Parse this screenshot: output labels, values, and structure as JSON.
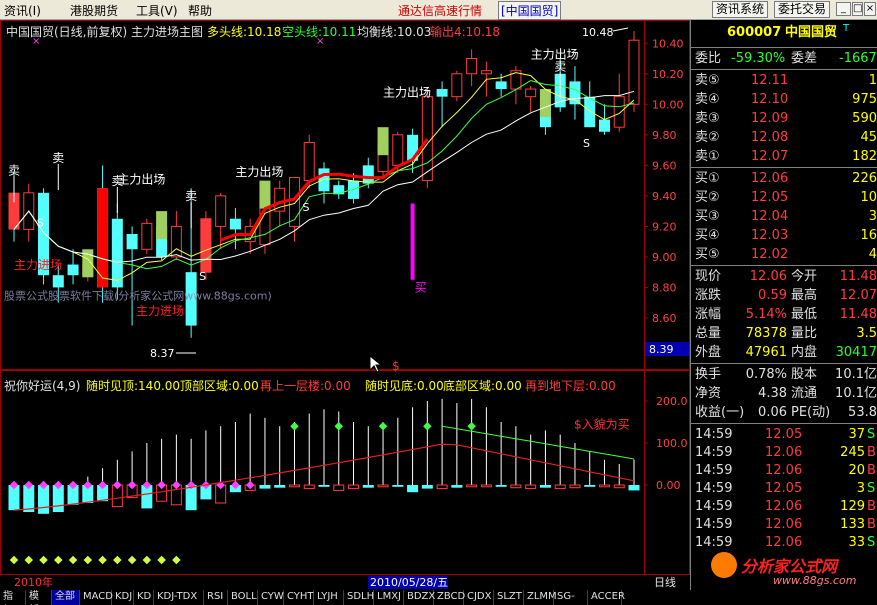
{
  "menubar": {
    "items": [
      "资讯(I)",
      "港股期货",
      "工具(V)",
      "帮助"
    ],
    "title": "通达信高速行情",
    "stock_tag": "[中国国贸]",
    "btn_news": "资讯系统",
    "btn_trade": "委托交易",
    "win_min": "_",
    "win_max": "□",
    "win_close": "×"
  },
  "main_legend": {
    "name": "中国国贸(日线,前复权) 主力进场主图",
    "bull": "多头线:10.18",
    "bear": "空头线:10.11",
    "balance": "均衡线:10.03",
    "output": "输出4:10.18"
  },
  "price_axis": [
    "10.40",
    "10.20",
    "10.00",
    "9.80",
    "9.60",
    "9.40",
    "9.20",
    "9.00",
    "8.80",
    "8.60",
    "8.39"
  ],
  "annotations": {
    "high": "10.48",
    "low": "8.37",
    "sell": "卖",
    "buy": "买",
    "s": "S",
    "main_out": "主力出场",
    "main_in": "主力进场",
    "dollar": "$",
    "watermark": "股票公式股票软件下载(分析家公式网www.88gs.com)"
  },
  "sub_legend": {
    "name": "祝你好运(4,9)",
    "a": "随时见顶:140.00",
    "b": "顶部区域:0.00",
    "c": "再上一层楼:0.00",
    "d": "随时见底:0.00",
    "e": "底部区域:0.00",
    "f": "再到地下层:0.00"
  },
  "sub_axis": [
    "200.0",
    "100.0",
    "0.00"
  ],
  "sub_annotation": "$入貌为买",
  "date_left": "2010年",
  "date_cursor": "2010/05/28/五",
  "date_right": "日线",
  "chart_data": {
    "type": "candlestick",
    "ylim": [
      8.39,
      10.5
    ],
    "candles": [
      {
        "o": 9.42,
        "c": 9.18,
        "h": 9.55,
        "l": 9.1
      },
      {
        "o": 9.18,
        "c": 9.42,
        "h": 9.48,
        "l": 9.1
      },
      {
        "o": 9.42,
        "c": 8.88,
        "h": 9.45,
        "l": 8.82
      },
      {
        "o": 8.88,
        "c": 8.8,
        "h": 8.95,
        "l": 8.7
      },
      {
        "o": 8.95,
        "c": 8.88,
        "h": 9.05,
        "l": 8.82
      },
      {
        "o": 8.88,
        "c": 8.95,
        "h": 9.02,
        "l": 8.84
      },
      {
        "o": 9.45,
        "c": 8.8,
        "h": 9.6,
        "l": 8.7
      },
      {
        "o": 9.25,
        "c": 8.8,
        "h": 9.35,
        "l": 8.72
      },
      {
        "o": 9.15,
        "c": 9.05,
        "h": 9.2,
        "l": 8.55
      },
      {
        "o": 9.05,
        "c": 9.22,
        "h": 9.25,
        "l": 9.02
      },
      {
        "o": 9.2,
        "c": 9.0,
        "h": 9.24,
        "l": 8.98
      },
      {
        "o": 9.0,
        "c": 9.2,
        "h": 9.3,
        "l": 8.98
      },
      {
        "o": 8.9,
        "c": 8.55,
        "h": 9.45,
        "l": 8.47
      },
      {
        "o": 8.9,
        "c": 9.25,
        "h": 9.3,
        "l": 8.85
      },
      {
        "o": 9.2,
        "c": 9.4,
        "h": 9.42,
        "l": 9.05
      },
      {
        "o": 9.25,
        "c": 9.18,
        "h": 9.32,
        "l": 9.05
      },
      {
        "o": 9.1,
        "c": 9.2,
        "h": 9.25,
        "l": 9.02
      },
      {
        "o": 9.08,
        "c": 9.4,
        "h": 9.45,
        "l": 9.02
      },
      {
        "o": 9.3,
        "c": 9.45,
        "h": 9.5,
        "l": 9.2
      },
      {
        "o": 9.2,
        "c": 9.52,
        "h": 9.52,
        "l": 9.1
      },
      {
        "o": 9.5,
        "c": 9.75,
        "h": 9.8,
        "l": 9.45
      },
      {
        "o": 9.58,
        "c": 9.43,
        "h": 9.62,
        "l": 9.35
      },
      {
        "o": 9.47,
        "c": 9.41,
        "h": 9.5,
        "l": 9.38
      },
      {
        "o": 9.5,
        "c": 9.38,
        "h": 9.55,
        "l": 9.35
      },
      {
        "o": 9.6,
        "c": 9.48,
        "h": 9.65,
        "l": 9.45
      },
      {
        "o": 9.56,
        "c": 9.75,
        "h": 9.8,
        "l": 9.52
      },
      {
        "o": 9.6,
        "c": 9.8,
        "h": 9.82,
        "l": 9.55
      },
      {
        "o": 9.8,
        "c": 9.63,
        "h": 9.84,
        "l": 9.55
      },
      {
        "o": 9.5,
        "c": 10.05,
        "h": 10.1,
        "l": 9.45
      },
      {
        "o": 10.1,
        "c": 10.05,
        "h": 10.15,
        "l": 9.85
      },
      {
        "o": 10.05,
        "c": 10.2,
        "h": 10.22,
        "l": 10.02
      },
      {
        "o": 10.2,
        "c": 10.3,
        "h": 10.36,
        "l": 10.12
      },
      {
        "o": 10.2,
        "c": 10.22,
        "h": 10.28,
        "l": 10.05
      },
      {
        "o": 10.15,
        "c": 10.1,
        "h": 10.2,
        "l": 10.05
      },
      {
        "o": 10.1,
        "c": 10.22,
        "h": 10.25,
        "l": 10.0
      },
      {
        "o": 10.05,
        "c": 10.1,
        "h": 10.12,
        "l": 9.95
      },
      {
        "o": 10.0,
        "c": 9.85,
        "h": 10.1,
        "l": 9.8
      },
      {
        "o": 10.2,
        "c": 9.98,
        "h": 10.3,
        "l": 9.95
      },
      {
        "o": 10.15,
        "c": 10.0,
        "h": 10.25,
        "l": 9.9
      },
      {
        "o": 10.05,
        "c": 9.85,
        "h": 10.15,
        "l": 9.85
      },
      {
        "o": 9.9,
        "c": 9.82,
        "h": 10.0,
        "l": 9.8
      },
      {
        "o": 9.85,
        "c": 10.05,
        "h": 10.2,
        "l": 9.82
      },
      {
        "o": 10.0,
        "c": 10.42,
        "h": 10.48,
        "l": 9.95
      }
    ]
  },
  "panel": {
    "code": "600007",
    "name": "中国国贸",
    "weibi_label": "委比",
    "weibi_value": "-59.30%",
    "weicha_label": "委差",
    "weicha_value": "-1667",
    "sells": [
      {
        "label": "卖⑤",
        "price": "12.11",
        "vol": "1"
      },
      {
        "label": "卖④",
        "price": "12.10",
        "vol": "975"
      },
      {
        "label": "卖③",
        "price": "12.09",
        "vol": "590"
      },
      {
        "label": "卖②",
        "price": "12.08",
        "vol": "45"
      },
      {
        "label": "卖①",
        "price": "12.07",
        "vol": "182"
      }
    ],
    "buys": [
      {
        "label": "买①",
        "price": "12.06",
        "vol": "226"
      },
      {
        "label": "买②",
        "price": "12.05",
        "vol": "10"
      },
      {
        "label": "买③",
        "price": "12.04",
        "vol": "3"
      },
      {
        "label": "买④",
        "price": "12.03",
        "vol": "16"
      },
      {
        "label": "买⑤",
        "price": "12.02",
        "vol": "4"
      }
    ],
    "stats": [
      {
        "l1": "现价",
        "v1": "12.06",
        "l2": "今开",
        "v2": "11.48"
      },
      {
        "l1": "涨跌",
        "v1": "0.59",
        "l2": "最高",
        "v2": "12.07"
      },
      {
        "l1": "涨幅",
        "v1": "5.14%",
        "l2": "最低",
        "v2": "11.48"
      },
      {
        "l1": "总量",
        "v1": "78378",
        "l2": "量比",
        "v2": "3.5"
      },
      {
        "l1": "外盘",
        "v1": "47961",
        "l2": "内盘",
        "v2": "30417"
      }
    ],
    "stats2": [
      {
        "l1": "换手",
        "v1": "0.78%",
        "l2": "股本",
        "v2": "10.1亿"
      },
      {
        "l1": "净资",
        "v1": "4.38",
        "l2": "流通",
        "v2": "10.1亿"
      },
      {
        "l1": "收益(一)",
        "v1": "0.06",
        "l2": "PE(动)",
        "v2": "53.8"
      }
    ],
    "ticks": [
      {
        "t": "14:59",
        "p": "12.05",
        "v": "37",
        "d": "S"
      },
      {
        "t": "14:59",
        "p": "12.06",
        "v": "245",
        "d": "B"
      },
      {
        "t": "14:59",
        "p": "12.06",
        "v": "20",
        "d": "B"
      },
      {
        "t": "14:59",
        "p": "12.05",
        "v": "3",
        "d": "S"
      },
      {
        "t": "14:59",
        "p": "12.06",
        "v": "129",
        "d": "B"
      },
      {
        "t": "14:59",
        "p": "12.06",
        "v": "133",
        "d": "B"
      },
      {
        "t": "14:59",
        "p": "12.06",
        "v": "33",
        "d": "S"
      }
    ],
    "logo": "分析家公式网",
    "logo_url": "www.88gs.com"
  },
  "tabs": [
    "指标",
    "模板",
    "全部",
    "MACD",
    "KDJ",
    "KD",
    "KDJ-TDX",
    "RSI",
    "BOLL",
    "CYW",
    "CYHT",
    "LYJH",
    "SDLH",
    "LMXJ",
    "BDZX",
    "ZBCD",
    "CJDX",
    "SLZT",
    "ZLMM",
    "SG-LB",
    "ACCER"
  ]
}
